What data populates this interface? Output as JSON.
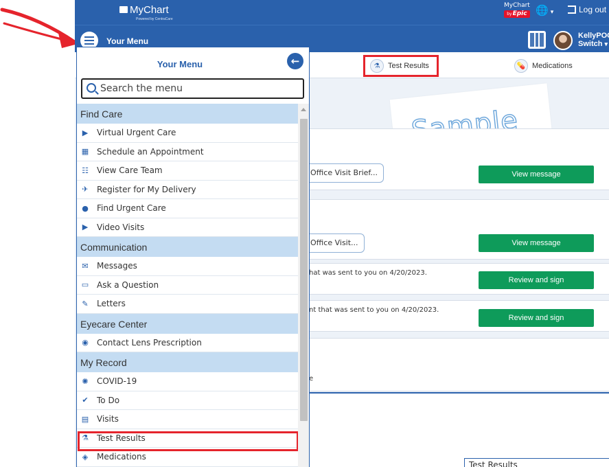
{
  "header": {
    "logo": "MyChart",
    "logo_sub": "Powered by CentraCare",
    "mychart_by": "MyChart",
    "by_label": "by",
    "epic": "Epic",
    "logout": "Log out",
    "user_name": "KellyPOC",
    "switch": "Switch"
  },
  "nav": {
    "menu_label": "Your Menu"
  },
  "tabs": [
    {
      "label": "Test Results"
    },
    {
      "label": "Medications"
    }
  ],
  "watermark": "Sample",
  "cards": [
    {
      "pill": "Office Visit Brief...",
      "button": "View message"
    },
    {
      "pill": "Office Visit...",
      "button": "View message"
    },
    {
      "text": "hat was sent to you on 4/20/2023.",
      "button": "Review and sign"
    },
    {
      "text": "nt that was sent to you on 4/20/2023.",
      "button": "Review and sign"
    },
    {
      "text": "e"
    }
  ],
  "tooltip": "Test Results",
  "menu": {
    "title": "Your Menu",
    "search_placeholder": "Search the menu",
    "sections": [
      {
        "title": "Find Care",
        "items": [
          {
            "label": "Virtual Urgent Care",
            "icon": "video-icon"
          },
          {
            "label": "Schedule an Appointment",
            "icon": "calendar-plus-icon"
          },
          {
            "label": "View Care Team",
            "icon": "care-team-icon"
          },
          {
            "label": "Register for My Delivery",
            "icon": "stork-icon"
          },
          {
            "label": "Find Urgent Care",
            "icon": "map-pin-icon"
          },
          {
            "label": "Video Visits",
            "icon": "video-icon"
          }
        ]
      },
      {
        "title": "Communication",
        "items": [
          {
            "label": "Messages",
            "icon": "envelope-icon"
          },
          {
            "label": "Ask a Question",
            "icon": "chat-icon"
          },
          {
            "label": "Letters",
            "icon": "letter-icon"
          }
        ]
      },
      {
        "title": "Eyecare Center",
        "items": [
          {
            "label": "Contact Lens Prescription",
            "icon": "eye-icon"
          }
        ]
      },
      {
        "title": "My Record",
        "items": [
          {
            "label": "COVID-19",
            "icon": "virus-icon"
          },
          {
            "label": "To Do",
            "icon": "check-circle-icon"
          },
          {
            "label": "Visits",
            "icon": "calendar-icon"
          },
          {
            "label": "Test Results",
            "icon": "flask-icon"
          },
          {
            "label": "Medications",
            "icon": "pill-icon"
          }
        ]
      }
    ]
  },
  "colors": {
    "brand_blue": "#2a61ac",
    "button_green": "#0e9b5a",
    "highlight_red": "#e5242c",
    "section_bg": "#c4dcf2"
  }
}
